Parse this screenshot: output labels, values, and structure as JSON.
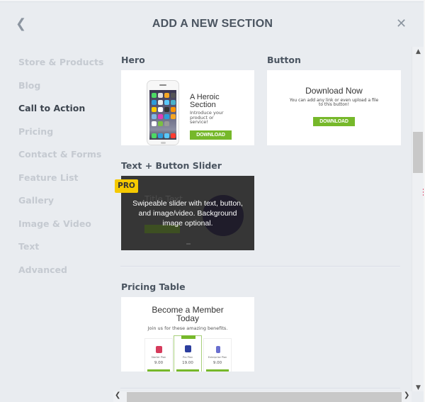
{
  "header": {
    "title": "ADD A NEW SECTION",
    "back_icon": "chevron-left-icon",
    "close_icon": "close-icon"
  },
  "sidebar": {
    "items": [
      {
        "label": "Store & Products",
        "active": false
      },
      {
        "label": "Blog",
        "active": false
      },
      {
        "label": "Call to Action",
        "active": true
      },
      {
        "label": "Pricing",
        "active": false
      },
      {
        "label": "Contact & Forms",
        "active": false
      },
      {
        "label": "Feature List",
        "active": false
      },
      {
        "label": "Gallery",
        "active": false
      },
      {
        "label": "Image & Video",
        "active": false
      },
      {
        "label": "Text",
        "active": false
      },
      {
        "label": "Advanced",
        "active": false
      }
    ]
  },
  "sections": {
    "hero": {
      "title": "Hero",
      "preview_heading": "A Heroic Section",
      "preview_text": "Introduce your product or service!",
      "preview_button": "DOWNLOAD"
    },
    "button": {
      "title": "Button",
      "preview_heading": "Download Now",
      "preview_text": "You can add any link or even upload a file to this button!",
      "preview_button": "DOWNLOAD"
    },
    "slider": {
      "title": "Text + Button Slider",
      "badge": "PRO",
      "ghost_title": "Title Text",
      "description": "Swipeable slider with text, button, and image/video. Background image optional."
    },
    "pricing": {
      "title": "Pricing Table",
      "preview_heading": "Become a Member Today",
      "preview_subtext": "Join us for these amazing benefits.",
      "plans": [
        {
          "name": "Starter Plan",
          "price": "9.00"
        },
        {
          "name": "Pro Plan",
          "price": "19.00"
        },
        {
          "name": "Enterprise Plan",
          "price": "9.00"
        }
      ]
    }
  },
  "colors": {
    "accent_green": "#76b82a",
    "pro_badge": "#f5c900",
    "active_text": "#3e4650",
    "inactive_text": "#c5cad1"
  }
}
